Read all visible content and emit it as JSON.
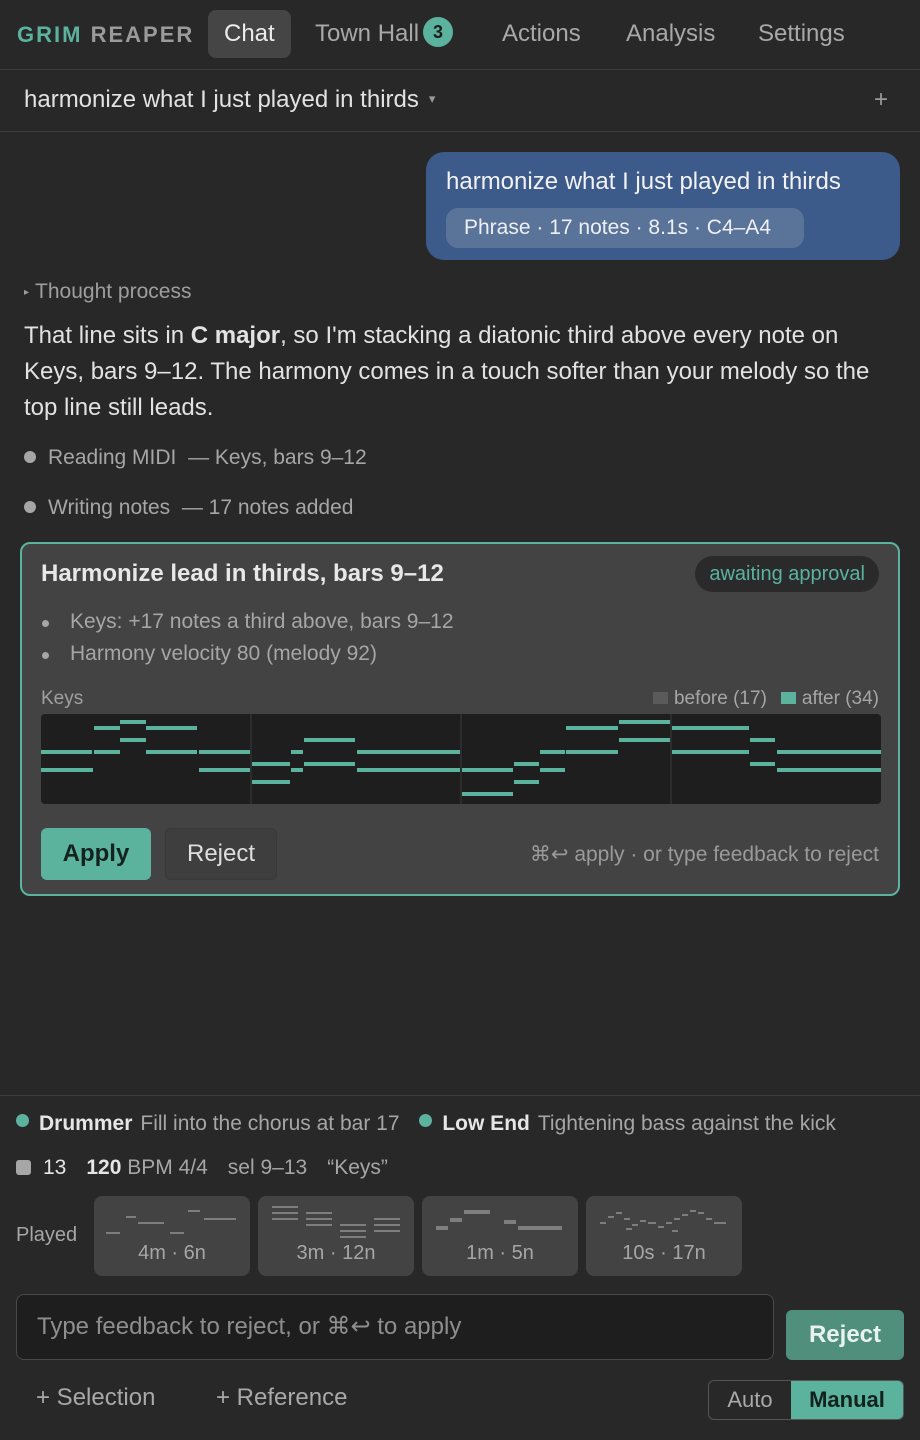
{
  "brand": {
    "part1": "GRIM",
    "part2": "REAPER"
  },
  "tabs": [
    {
      "label": "Chat"
    },
    {
      "label": "Town Hall",
      "badge": "3"
    },
    {
      "label": "Actions"
    },
    {
      "label": "Analysis"
    },
    {
      "label": "Settings"
    }
  ],
  "thread": {
    "title": "harmonize what I just played in thirds",
    "caret": "▾",
    "add": "+"
  },
  "user_message": {
    "text": "harmonize what I just played in thirds",
    "chip": "Phrase · 17 notes · 8.1s · C4–A4"
  },
  "assistant": {
    "thought_label": "Thought process",
    "text_before": "That line sits in ",
    "text_bold": "C major",
    "text_after": ", so I'm stacking a diatonic third above every note on Keys, bars 9–12. The harmony comes in a touch softer than your melody so the top line still leads.",
    "steps": [
      {
        "label": "Reading MIDI",
        "detail": "— Keys, bars 9–12"
      },
      {
        "label": "Writing notes",
        "detail": "— 17 notes added"
      }
    ]
  },
  "action_card": {
    "title": "Harmonize lead in thirds, bars 9–12",
    "status": "awaiting approval",
    "bullets": [
      "Keys: +17 notes a third above, bars 9–12",
      "Harmony velocity 80 (melody 92)"
    ],
    "track_label": "Keys",
    "legend_before": "before (17)",
    "legend_after": "after (34)",
    "apply_label": "Apply",
    "reject_label": "Reject",
    "hint": "⌘↩ apply · or type feedback to reject"
  },
  "colors": {
    "accent": "#5bb39e",
    "user_bubble": "#3c5a8a",
    "before_note": "#5a5a5a"
  },
  "agents": [
    {
      "name": "Drummer",
      "message": "Fill into the chorus at bar 17"
    },
    {
      "name": "Low End",
      "message": "Tightening bass against the kick"
    }
  ],
  "status": {
    "count": "13",
    "bpm": "120",
    "bpm_unit": "BPM 4/4",
    "selection": "sel 9–13",
    "track": "“Keys”"
  },
  "played": {
    "label": "Played",
    "clips": [
      {
        "label": "4m · 6n"
      },
      {
        "label": "3m · 12n"
      },
      {
        "label": "1m · 5n"
      },
      {
        "label": "10s · 17n"
      }
    ]
  },
  "composer": {
    "placeholder": "Type feedback to reject, or ⌘↩ to apply",
    "reject_label": "Reject",
    "add_selection": "+ Selection",
    "add_reference": "+ Reference",
    "mode_auto": "Auto",
    "mode_manual": "Manual",
    "mode_selected": "Manual"
  }
}
